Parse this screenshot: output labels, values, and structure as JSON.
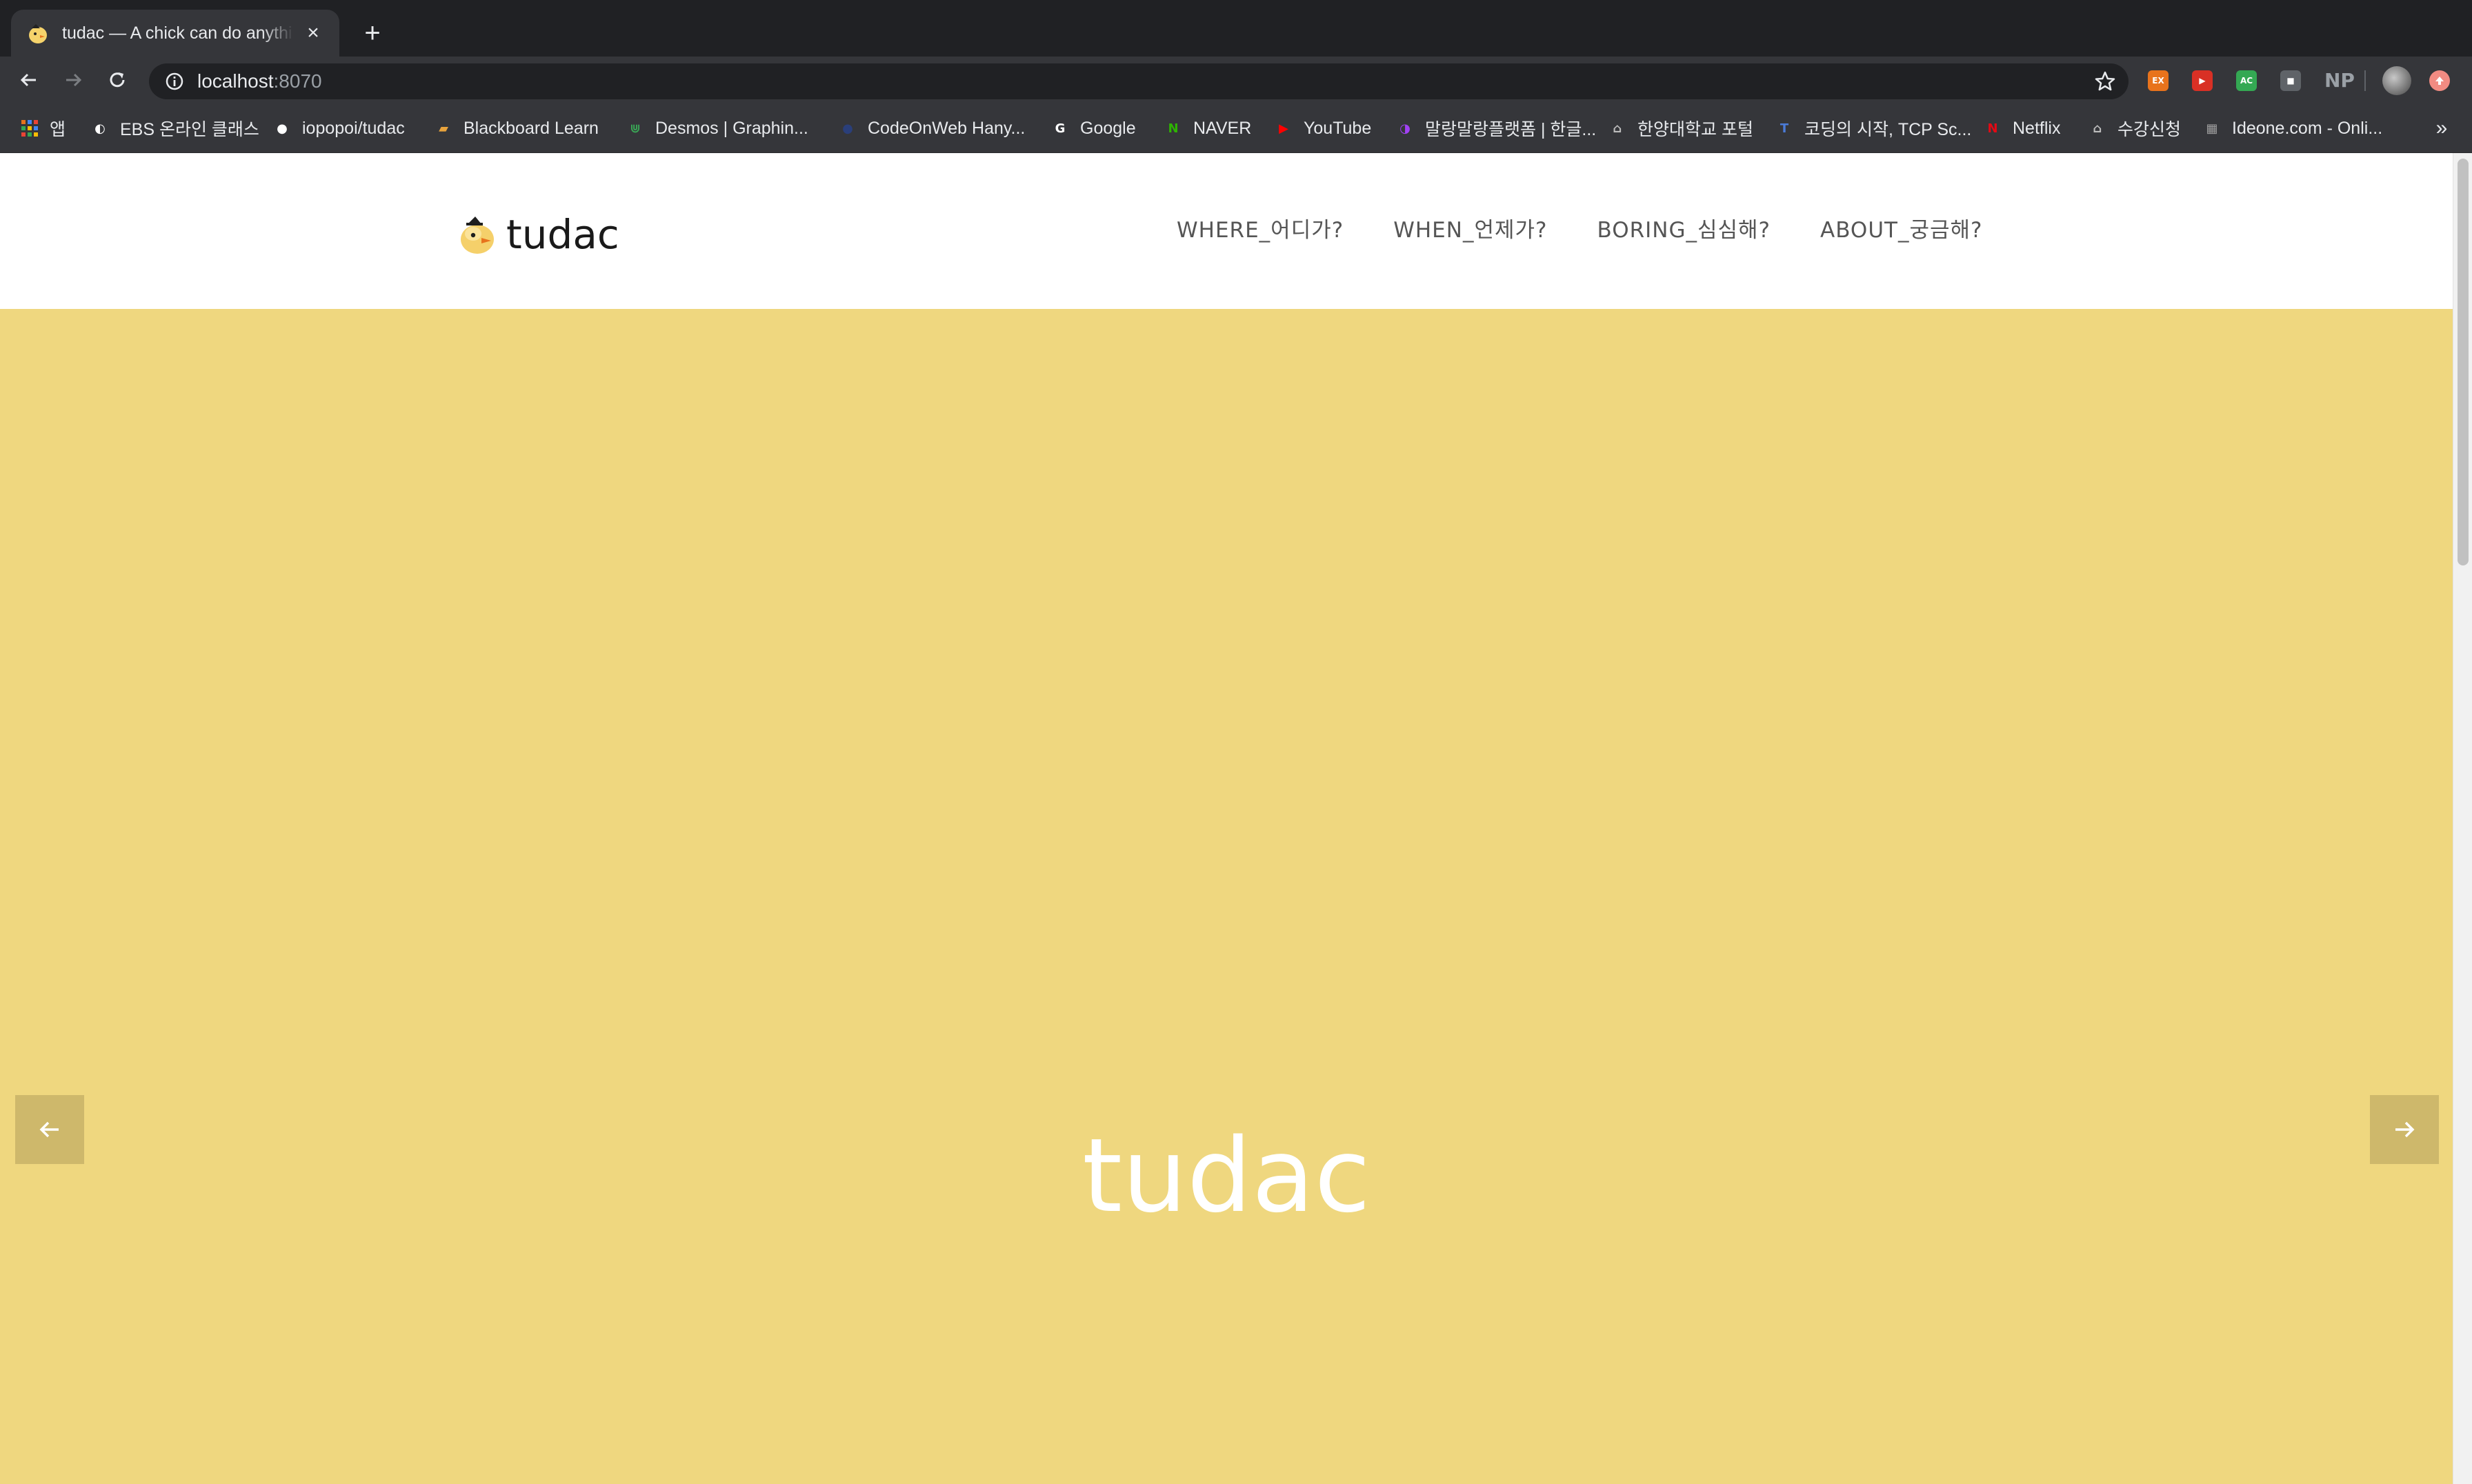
{
  "browser": {
    "tab": {
      "title": "tudac — A chick can do anything",
      "favicon": "chick-logo-icon"
    },
    "address": {
      "host": "localhost",
      "port": ":8070"
    },
    "extensions": [
      {
        "name": "ex-extension-icon",
        "label": "EX",
        "color": "#e8731c"
      },
      {
        "name": "video-extension-icon",
        "label": "▶",
        "color": "#d93025"
      },
      {
        "name": "ac-extension-icon",
        "label": "AC",
        "color": "#34a853"
      },
      {
        "name": "screen-extension-icon",
        "label": "■",
        "color": "#5f6368"
      }
    ],
    "np_label": "NP",
    "bookmarks": {
      "apps": "앱",
      "items": [
        {
          "label": "EBS 온라인 클래스",
          "icon": "globe-icon",
          "color": "#ffffff",
          "glyph": "◐"
        },
        {
          "label": "iopopoi/tudac",
          "icon": "github-icon",
          "color": "#ffffff",
          "glyph": "●"
        },
        {
          "label": "Blackboard Learn",
          "icon": "blackboard-icon",
          "color": "#e8a33c",
          "glyph": "▰"
        },
        {
          "label": "Desmos | Graphin...",
          "icon": "desmos-icon",
          "color": "#3aa856",
          "glyph": "⋓"
        },
        {
          "label": "CodeOnWeb Hany...",
          "icon": "codeonweb-icon",
          "color": "#2a3f7a",
          "glyph": "●"
        },
        {
          "label": "Google",
          "icon": "google-icon",
          "color": "#ffffff",
          "glyph": "G"
        },
        {
          "label": "NAVER",
          "icon": "naver-icon",
          "color": "#2db400",
          "glyph": "N"
        },
        {
          "label": "YouTube",
          "icon": "youtube-icon",
          "color": "#ff0000",
          "glyph": "▶"
        },
        {
          "label": "말랑말랑플랫폼 | 한글...",
          "icon": "malang-icon",
          "color": "#a142f4",
          "glyph": "◑"
        },
        {
          "label": "한양대학교 포털",
          "icon": "hanyang-icon",
          "color": "#bdbdbd",
          "glyph": "⌂"
        },
        {
          "label": "코딩의 시작, TCP Sc...",
          "icon": "tcp-school-icon",
          "color": "#4a7bd8",
          "glyph": "T"
        },
        {
          "label": "Netflix",
          "icon": "netflix-icon",
          "color": "#e50914",
          "glyph": "N"
        },
        {
          "label": "수강신청",
          "icon": "registration-icon",
          "color": "#bdbdbd",
          "glyph": "⌂"
        },
        {
          "label": "Ideone.com - Onli...",
          "icon": "ideone-icon",
          "color": "#9e9e9e",
          "glyph": "▦"
        }
      ],
      "more": "»"
    }
  },
  "site": {
    "logo_text": "tudac",
    "nav": [
      {
        "label": "WHERE_어디가?"
      },
      {
        "label": "WHEN_언제가?"
      },
      {
        "label": "BORING_심심해?"
      },
      {
        "label": "ABOUT_궁금해?"
      }
    ],
    "hero": {
      "title": "tudac",
      "background": "#efd77f"
    }
  }
}
